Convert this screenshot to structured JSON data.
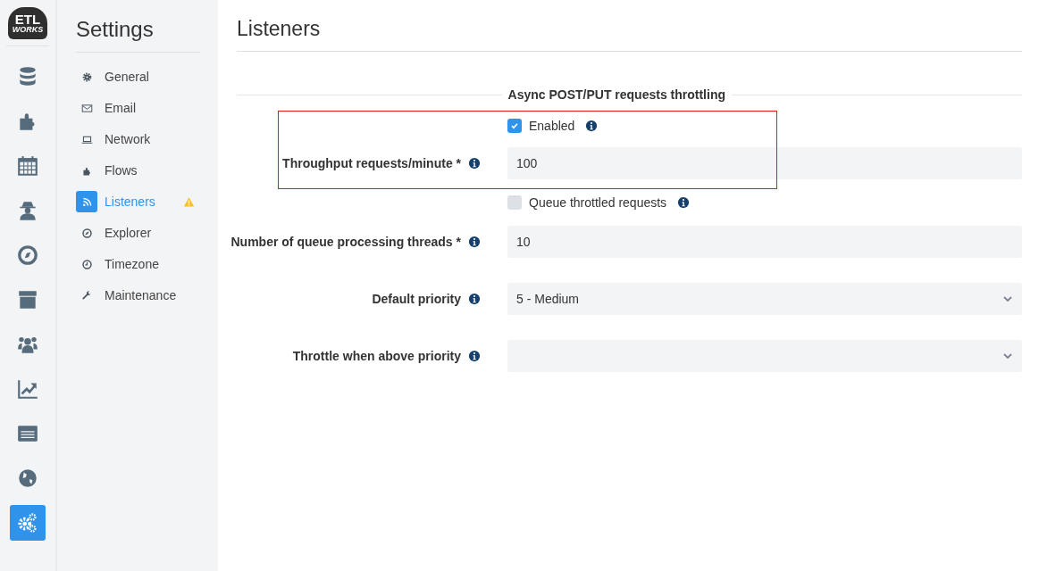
{
  "logo": {
    "line1": "ETL",
    "line2": "WORKS"
  },
  "rail": [
    {
      "selected": false
    },
    {
      "selected": false
    },
    {
      "selected": false
    },
    {
      "selected": false
    },
    {
      "selected": false
    },
    {
      "selected": false
    },
    {
      "selected": false
    },
    {
      "selected": false
    },
    {
      "selected": false
    },
    {
      "selected": false
    },
    {
      "selected": true
    }
  ],
  "settings": {
    "title": "Settings",
    "items": [
      {
        "label": "General",
        "selected": false,
        "warning": false
      },
      {
        "label": "Email",
        "selected": false,
        "warning": false
      },
      {
        "label": "Network",
        "selected": false,
        "warning": false
      },
      {
        "label": "Flows",
        "selected": false,
        "warning": false
      },
      {
        "label": "Listeners",
        "selected": true,
        "warning": true
      },
      {
        "label": "Explorer",
        "selected": false,
        "warning": false
      },
      {
        "label": "Timezone",
        "selected": false,
        "warning": false
      },
      {
        "label": "Maintenance",
        "selected": false,
        "warning": false
      }
    ]
  },
  "page": {
    "title": "Listeners",
    "section": "Async POST/PUT requests throttling",
    "highlighted_rows": [
      {
        "kind": "checkbox",
        "label": "Enabled",
        "checked": true
      },
      {
        "kind": "input",
        "label": "Throughput requests/minute *",
        "value": "100"
      }
    ],
    "rows": [
      {
        "kind": "checkbox",
        "label": "Queue throttled requests",
        "checked": false
      },
      {
        "kind": "input",
        "label": "Number of queue processing threads *",
        "value": "10"
      },
      {
        "kind": "select",
        "label": "Default priority",
        "value": "5 - Medium"
      },
      {
        "kind": "select",
        "label": "Throttle when above priority"
      }
    ]
  }
}
